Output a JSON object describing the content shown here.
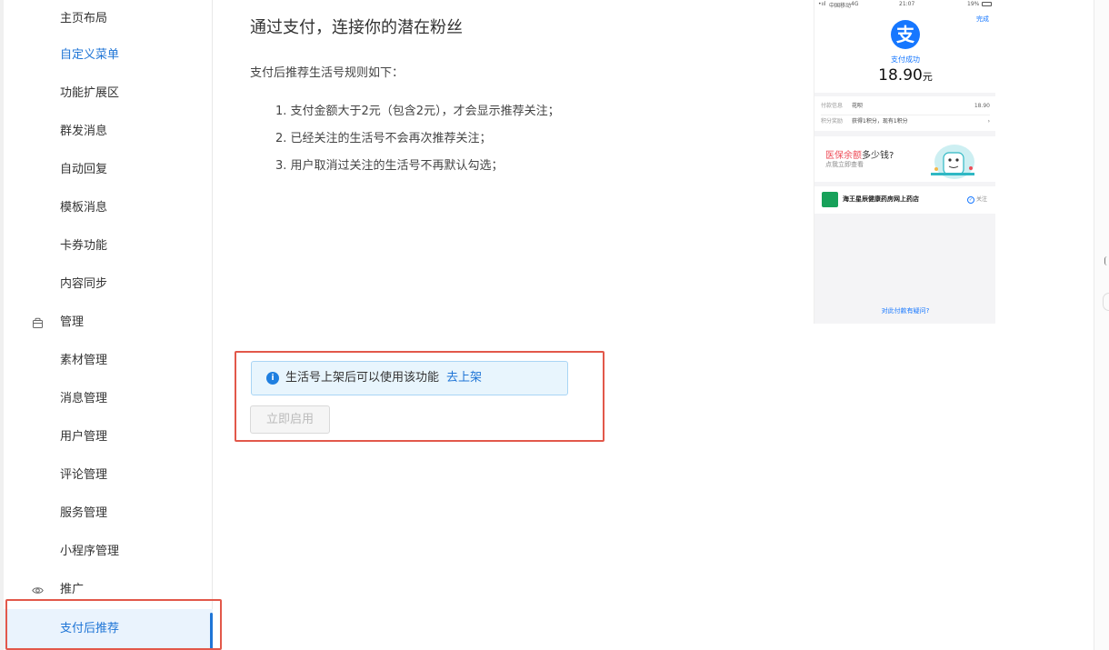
{
  "sidebar": {
    "items": [
      {
        "label": "主页布局",
        "state": "normal"
      },
      {
        "label": "自定义菜单",
        "state": "link"
      },
      {
        "label": "功能扩展区",
        "state": "normal"
      },
      {
        "label": "群发消息",
        "state": "normal"
      },
      {
        "label": "自动回复",
        "state": "normal"
      },
      {
        "label": "模板消息",
        "state": "normal"
      },
      {
        "label": "卡券功能",
        "state": "normal"
      },
      {
        "label": "内容同步",
        "state": "normal"
      }
    ],
    "group_manage": {
      "label": "管理",
      "icon": "bag-icon"
    },
    "manage_items": [
      {
        "label": "素材管理"
      },
      {
        "label": "消息管理"
      },
      {
        "label": "用户管理"
      },
      {
        "label": "评论管理"
      },
      {
        "label": "服务管理"
      },
      {
        "label": "小程序管理"
      }
    ],
    "group_promo": {
      "label": "推广",
      "icon": "eye-icon"
    },
    "promo_items": [
      {
        "label": "支付后推荐",
        "state": "active"
      }
    ]
  },
  "main": {
    "title": "通过支付，连接你的潜在粉丝",
    "desc": "支付后推荐生活号规则如下：",
    "rules": [
      "1. 支付金额大于2元（包含2元），才会显示推荐关注；",
      "2. 已经关注的生活号不会再次推荐关注；",
      "3. 用户取消过关注的生活号不再默认勾选；"
    ],
    "notice": {
      "text": "生活号上架后可以使用该功能",
      "link": "去上架",
      "icon": "info-icon"
    },
    "enable_button": "立即启用"
  },
  "phone": {
    "status_carrier": "中国移动",
    "status_net": "4G",
    "status_time": "21:07",
    "status_battery": "19%",
    "done": "完成",
    "logo_glyph": "支",
    "pay_success": "支付成功",
    "amount": "18.90",
    "amount_unit": "元",
    "rows": [
      {
        "key": "付款信息",
        "value": "花呗",
        "right": "18.90"
      },
      {
        "key": "积分奖励",
        "value": "获得1积分，现有1积分",
        "right": "›"
      }
    ],
    "banner": {
      "highlight": "医保余额",
      "title_rest": "多少钱?",
      "sub": "点我立即查看"
    },
    "shop": {
      "name": "海王星辰健康药房网上药店",
      "follow": "关注"
    },
    "question": "对此付款有疑问?"
  },
  "colors": {
    "accent": "#1f75d6",
    "highlight_border": "#e2584a",
    "alipay": "#1677ff",
    "notice_bg": "#e8f5fd"
  }
}
